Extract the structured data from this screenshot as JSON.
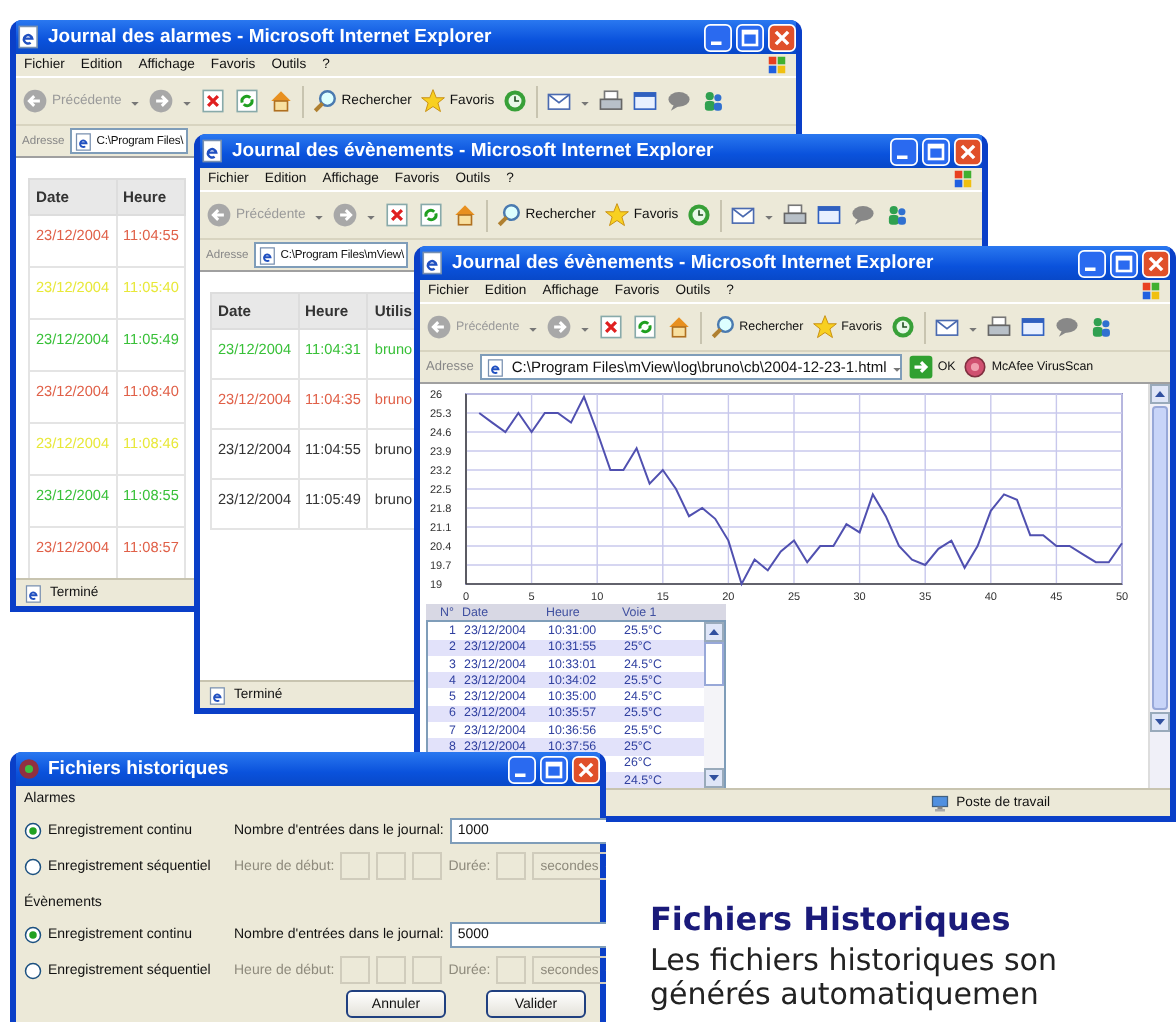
{
  "windows": [
    {
      "title": "Journal des alarmes - Microsoft Internet Explorer",
      "menu": [
        "Fichier",
        "Edition",
        "Affichage",
        "Favoris",
        "Outils",
        "?"
      ],
      "toolbar": {
        "back": "Précédente",
        "search": "Rechercher",
        "favorites": "Favoris"
      },
      "address": {
        "label": "Adresse",
        "value": "C:\\Program Files\\"
      },
      "table": {
        "columns": [
          "Date",
          "Heure"
        ],
        "rows": [
          {
            "cells": [
              "23/12/2004",
              "11:04:55"
            ],
            "color": "#e06048"
          },
          {
            "cells": [
              "23/12/2004",
              "11:05:40"
            ],
            "color": "#e8e838"
          },
          {
            "cells": [
              "23/12/2004",
              "11:05:49"
            ],
            "color": "#38c038"
          },
          {
            "cells": [
              "23/12/2004",
              "11:08:40"
            ],
            "color": "#e06048"
          },
          {
            "cells": [
              "23/12/2004",
              "11:08:46"
            ],
            "color": "#e8e838"
          },
          {
            "cells": [
              "23/12/2004",
              "11:08:55"
            ],
            "color": "#38c038"
          },
          {
            "cells": [
              "23/12/2004",
              "11:08:57"
            ],
            "color": "#e06048"
          }
        ]
      },
      "status_bar": "Terminé"
    },
    {
      "title": "Journal des évènements - Microsoft Internet Explorer",
      "menu": [
        "Fichier",
        "Edition",
        "Affichage",
        "Favoris",
        "Outils",
        "?"
      ],
      "toolbar": {
        "back": "Précédente",
        "search": "Rechercher",
        "favorites": "Favoris"
      },
      "address": {
        "label": "Adresse",
        "value": "C:\\Program Files\\mView\\"
      },
      "table": {
        "columns": [
          "Date",
          "Heure",
          "Utilis"
        ],
        "rows": [
          {
            "cells": [
              "23/12/2004",
              "11:04:31",
              "bruno"
            ],
            "color": "#38c038"
          },
          {
            "cells": [
              "23/12/2004",
              "11:04:35",
              "bruno"
            ],
            "color": "#e06048"
          },
          {
            "cells": [
              "23/12/2004",
              "11:04:55",
              "bruno"
            ],
            "color": "#333333"
          },
          {
            "cells": [
              "23/12/2004",
              "11:05:49",
              "bruno"
            ],
            "color": "#333333"
          }
        ]
      },
      "status_bar": "Terminé"
    },
    {
      "title": "Journal des évènements - Microsoft Internet Explorer",
      "menu": [
        "Fichier",
        "Edition",
        "Affichage",
        "Favoris",
        "Outils",
        "?"
      ],
      "toolbar": {
        "back": "Précédente",
        "search": "Rechercher",
        "favorites": "Favoris"
      },
      "address": {
        "label": "Adresse",
        "value": "C:\\Program Files\\mView\\log\\bruno\\cb\\2004-12-23-1.html",
        "go": "OK",
        "plugin": "McAfee VirusScan"
      },
      "chart_data": {
        "type": "line",
        "grid": true,
        "x": [
          1,
          2,
          3,
          4,
          5,
          6,
          7,
          8,
          9,
          10,
          11,
          12,
          13,
          14,
          15,
          16,
          17,
          18,
          19,
          20,
          21,
          22,
          23,
          24,
          25,
          26,
          27,
          28,
          29,
          30,
          31,
          32,
          33,
          34,
          35,
          36,
          37,
          38,
          39,
          40,
          41,
          42,
          43,
          44,
          45,
          46,
          47,
          48,
          49,
          50
        ],
        "xlim": [
          0,
          50
        ],
        "ylim": [
          19,
          26
        ],
        "xticks": [
          0,
          5,
          10,
          15,
          20,
          25,
          30,
          35,
          40,
          45,
          50
        ],
        "yticks": [
          19,
          19.7,
          20.4,
          21.1,
          21.8,
          22.5,
          23.2,
          23.9,
          24.6,
          25.3,
          26
        ],
        "series": [
          {
            "color": "#5050b0",
            "values": [
              25.3,
              24.95,
              24.6,
              25.3,
              24.6,
              25.3,
              25.3,
              24.95,
              25.9,
              24.6,
              23.2,
              23.2,
              24.0,
              22.7,
              23.2,
              22.5,
              21.5,
              21.8,
              21.4,
              20.6,
              19.0,
              19.9,
              19.5,
              20.2,
              20.6,
              19.8,
              20.4,
              20.4,
              21.2,
              20.9,
              22.3,
              21.5,
              20.4,
              19.9,
              19.7,
              20.3,
              20.6,
              19.6,
              20.4,
              21.7,
              22.3,
              22.1,
              20.8,
              20.8,
              20.4,
              20.4,
              20.1,
              19.8,
              19.8,
              20.5
            ]
          }
        ]
      },
      "readings": {
        "columns": [
          "N°",
          "Date",
          "Heure",
          "Voie 1"
        ],
        "rows": [
          {
            "n": "1",
            "date": "23/12/2004",
            "time": "10:31:00",
            "value": "25.5°C"
          },
          {
            "n": "2",
            "date": "23/12/2004",
            "time": "10:31:55",
            "value": "25°C"
          },
          {
            "n": "3",
            "date": "23/12/2004",
            "time": "10:33:01",
            "value": "24.5°C"
          },
          {
            "n": "4",
            "date": "23/12/2004",
            "time": "10:34:02",
            "value": "25.5°C"
          },
          {
            "n": "5",
            "date": "23/12/2004",
            "time": "10:35:00",
            "value": "24.5°C"
          },
          {
            "n": "6",
            "date": "23/12/2004",
            "time": "10:35:57",
            "value": "25.5°C"
          },
          {
            "n": "7",
            "date": "23/12/2004",
            "time": "10:36:56",
            "value": "25.5°C"
          },
          {
            "n": "8",
            "date": "23/12/2004",
            "time": "10:37:56",
            "value": "25°C"
          },
          {
            "value": "26°C"
          },
          {
            "value": "24.5°C"
          }
        ]
      },
      "status_bar": "Poste de travail"
    }
  ],
  "dialog": {
    "title": "Fichiers historiques",
    "groups": [
      {
        "label": "Alarmes",
        "options": [
          {
            "kind": "count",
            "label": "Enregistrement continu",
            "selected": true,
            "field_label": "Nombre d'entrées dans le journal:",
            "value": "1000"
          },
          {
            "kind": "schedule",
            "label": "Enregistrement séquentiel",
            "selected": false,
            "disabled": true,
            "start_label": "Heure de début:",
            "duration_label": "Durée:",
            "unit": "secondes"
          }
        ]
      },
      {
        "label": "Évènements",
        "options": [
          {
            "kind": "count",
            "label": "Enregistrement continu",
            "selected": true,
            "field_label": "Nombre d'entrées dans le journal:",
            "value": "5000"
          },
          {
            "kind": "schedule",
            "label": "Enregistrement séquentiel",
            "selected": false,
            "disabled": true,
            "start_label": "Heure de début:",
            "duration_label": "Durée:",
            "unit": "secondes"
          }
        ]
      }
    ],
    "buttons": [
      "Annuler",
      "Valider"
    ]
  },
  "article": {
    "heading": "Fichiers Historiques",
    "text": "Les fichiers historiques son générés automatiquemen"
  }
}
